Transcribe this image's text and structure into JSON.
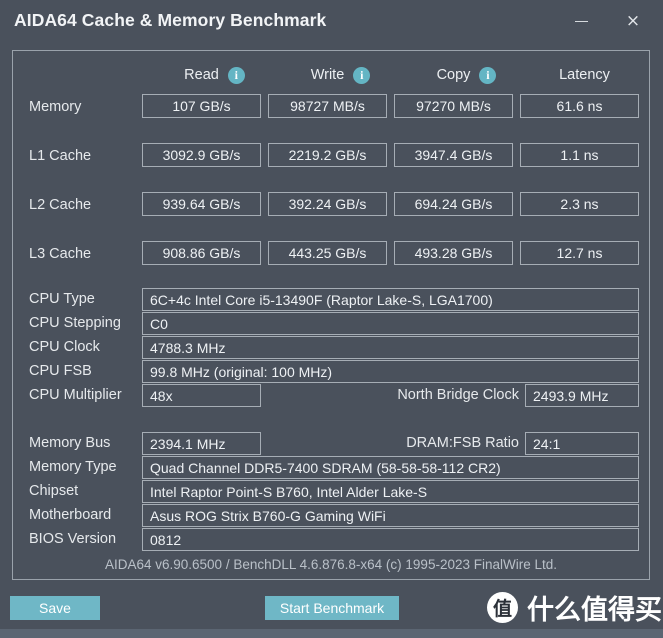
{
  "window": {
    "title": "AIDA64 Cache & Memory Benchmark",
    "minimize_label": "",
    "close_label": "×"
  },
  "benchmark": {
    "columns": [
      {
        "label": "Read",
        "has_info": true
      },
      {
        "label": "Write",
        "has_info": true
      },
      {
        "label": "Copy",
        "has_info": true
      },
      {
        "label": "Latency",
        "has_info": false
      }
    ],
    "rows": [
      {
        "label": "Memory",
        "read": "107  GB/s",
        "write": "98727 MB/s",
        "copy": "97270 MB/s",
        "latency": "61.6 ns"
      },
      {
        "label": "L1 Cache",
        "read": "3092.9 GB/s",
        "write": "2219.2 GB/s",
        "copy": "3947.4 GB/s",
        "latency": "1.1 ns"
      },
      {
        "label": "L2 Cache",
        "read": "939.64 GB/s",
        "write": "392.24 GB/s",
        "copy": "694.24 GB/s",
        "latency": "2.3 ns"
      },
      {
        "label": "L3 Cache",
        "read": "908.86 GB/s",
        "write": "443.25 GB/s",
        "copy": "493.28 GB/s",
        "latency": "12.7 ns"
      }
    ]
  },
  "cpu_info": {
    "cpu_type_label": "CPU Type",
    "cpu_type_value": "6C+4c Intel Core i5-13490F  (Raptor Lake-S, LGA1700)",
    "cpu_stepping_label": "CPU Stepping",
    "cpu_stepping_value": "C0",
    "cpu_clock_label": "CPU Clock",
    "cpu_clock_value": "4788.3 MHz",
    "cpu_fsb_label": "CPU FSB",
    "cpu_fsb_value": "99.8 MHz  (original: 100 MHz)",
    "cpu_multiplier_label": "CPU Multiplier",
    "cpu_multiplier_value": "48x",
    "north_bridge_label": "North Bridge Clock",
    "north_bridge_value": "2493.9 MHz"
  },
  "system_info": {
    "memory_bus_label": "Memory Bus",
    "memory_bus_value": "2394.1 MHz",
    "dram_fsb_label": "DRAM:FSB Ratio",
    "dram_fsb_value": "24:1",
    "memory_type_label": "Memory Type",
    "memory_type_value": "Quad Channel DDR5-7400 SDRAM  (58-58-58-112 CR2)",
    "chipset_label": "Chipset",
    "chipset_value": "Intel Raptor Point-S B760, Intel Alder Lake-S",
    "motherboard_label": "Motherboard",
    "motherboard_value": "Asus ROG Strix B760-G Gaming WiFi",
    "bios_label": "BIOS Version",
    "bios_value": "0812"
  },
  "footer": {
    "credit": "AIDA64 v6.90.6500 / BenchDLL 4.6.876.8-x64  (c) 1995-2023 FinalWire Ltd.",
    "save_button": "Save",
    "start_button": "Start Benchmark"
  },
  "watermark": {
    "logo_glyph": "值",
    "text": "什么值得买"
  },
  "colors": {
    "window_background": "#4a515c",
    "accent_teal": "#6fb7c6",
    "info_icon": "#64b5c4",
    "border": "#a6adb5",
    "text": "#eef1f4",
    "muted_text": "#b9c0c8"
  }
}
